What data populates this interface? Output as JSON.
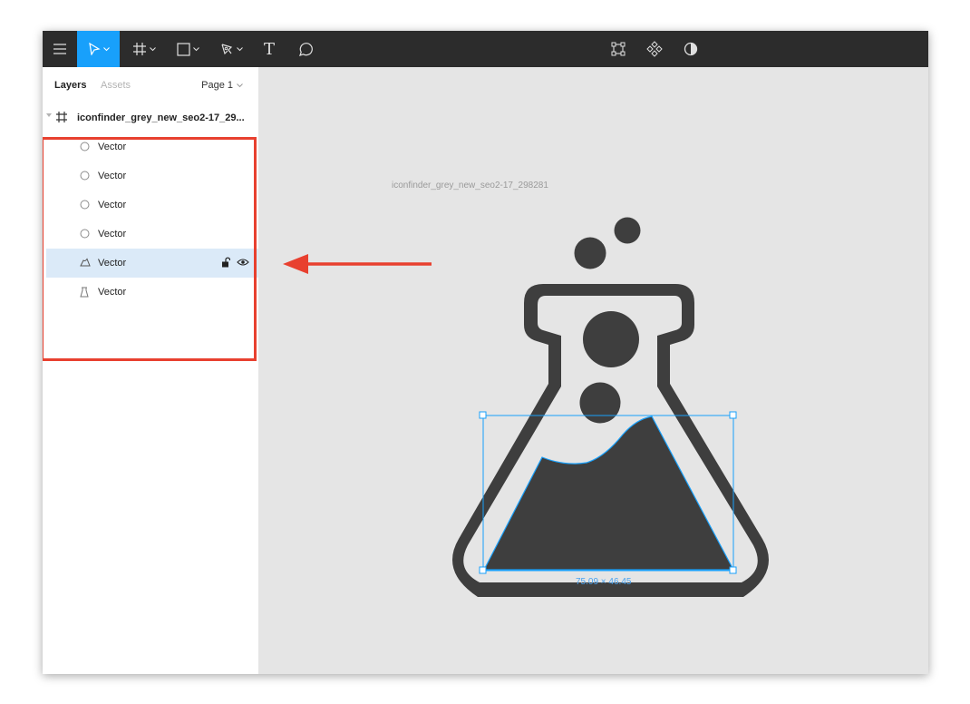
{
  "toolbar": {
    "tools": [
      "menu-icon",
      "move-tool-icon",
      "frame-tool-icon",
      "rectangle-tool-icon",
      "pen-tool-icon",
      "text-tool-icon",
      "comment-tool-icon"
    ],
    "center_tools": [
      "component-icon",
      "multi-edit-icon",
      "mask-icon"
    ],
    "text_tool_label": "T"
  },
  "sidebar": {
    "tabs": {
      "layers": "Layers",
      "assets": "Assets"
    },
    "page_selector": "Page 1",
    "frame": {
      "name": "iconfinder_grey_new_seo2-17_29...",
      "icon": "frame-icon"
    },
    "layers": [
      {
        "name": "Vector",
        "icon": "ellipse-icon",
        "selected": false
      },
      {
        "name": "Vector",
        "icon": "ellipse-icon",
        "selected": false
      },
      {
        "name": "Vector",
        "icon": "ellipse-icon",
        "selected": false
      },
      {
        "name": "Vector",
        "icon": "ellipse-icon",
        "selected": false
      },
      {
        "name": "Vector",
        "icon": "liquid-vector-icon",
        "selected": true
      },
      {
        "name": "Vector",
        "icon": "flask-vector-icon",
        "selected": false
      }
    ]
  },
  "canvas": {
    "frame_title": "iconfinder_grey_new_seo2-17_298281",
    "selection_dimensions": "75.09 × 46.45",
    "colors": {
      "icon": "#3e3e3e",
      "selection": "#18a0fb",
      "annotation": "#e8402f",
      "canvas_bg": "#e5e5e5"
    }
  }
}
